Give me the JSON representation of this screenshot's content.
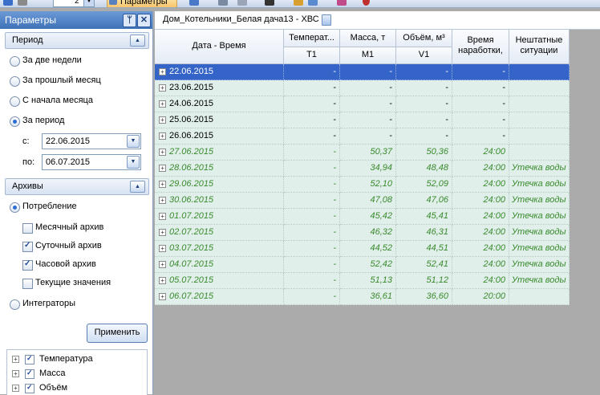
{
  "toolbar": {
    "spin_value": "2",
    "params_label": "Параметры"
  },
  "panel": {
    "title": "Параметры",
    "period": {
      "header": "Период",
      "options": [
        "За две недели",
        "За прошлый месяц",
        "С начала месяца",
        "За период"
      ],
      "selected": "За период",
      "from_label": "с:",
      "from_value": "22.06.2015",
      "to_label": "по:",
      "to_value": "06.07.2015"
    },
    "archives": {
      "header": "Архивы",
      "consumption_label": "Потребление",
      "checks": [
        {
          "label": "Месячный архив",
          "checked": false
        },
        {
          "label": "Суточный архив",
          "checked": true
        },
        {
          "label": "Часовой архив",
          "checked": true
        },
        {
          "label": "Текущие значения",
          "checked": false
        }
      ],
      "integrators_label": "Интеграторы"
    },
    "apply_label": "Применить",
    "tree": [
      {
        "label": "Температура",
        "checked": true
      },
      {
        "label": "Масса",
        "checked": true
      },
      {
        "label": "Объём",
        "checked": true
      }
    ]
  },
  "document": {
    "title": "Дом_Котельники_Белая дача13 - ХВС"
  },
  "grid": {
    "headers": {
      "date": "Дата - Время",
      "temp": "Температ...",
      "temp_sub": "T1",
      "mass": "Масса, т",
      "mass_sub": "M1",
      "vol": "Объём, м³",
      "vol_sub": "V1",
      "runtime1": "Время",
      "runtime2": "наработки,",
      "sit1": "Нештатные",
      "sit2": "ситуации"
    },
    "rows": [
      {
        "date": "22.06.2015",
        "temp": "-",
        "mass": "-",
        "vol": "-",
        "runtime": "-",
        "sit": "",
        "style": "sel"
      },
      {
        "date": "23.06.2015",
        "temp": "-",
        "mass": "-",
        "vol": "-",
        "runtime": "-",
        "sit": "",
        "style": "plain"
      },
      {
        "date": "24.06.2015",
        "temp": "-",
        "mass": "-",
        "vol": "-",
        "runtime": "-",
        "sit": "",
        "style": "plain"
      },
      {
        "date": "25.06.2015",
        "temp": "-",
        "mass": "-",
        "vol": "-",
        "runtime": "-",
        "sit": "",
        "style": "plain"
      },
      {
        "date": "26.06.2015",
        "temp": "-",
        "mass": "-",
        "vol": "-",
        "runtime": "-",
        "sit": "",
        "style": "plain"
      },
      {
        "date": "27.06.2015",
        "temp": "-",
        "mass": "50,37",
        "vol": "50,36",
        "runtime": "24:00",
        "sit": "",
        "style": "green"
      },
      {
        "date": "28.06.2015",
        "temp": "-",
        "mass": "34,94",
        "vol": "48,48",
        "runtime": "24:00",
        "sit": "Утечка воды",
        "style": "green"
      },
      {
        "date": "29.06.2015",
        "temp": "-",
        "mass": "52,10",
        "vol": "52,09",
        "runtime": "24:00",
        "sit": "Утечка воды",
        "style": "green"
      },
      {
        "date": "30.06.2015",
        "temp": "-",
        "mass": "47,08",
        "vol": "47,06",
        "runtime": "24:00",
        "sit": "Утечка воды",
        "style": "green"
      },
      {
        "date": "01.07.2015",
        "temp": "-",
        "mass": "45,42",
        "vol": "45,41",
        "runtime": "24:00",
        "sit": "Утечка воды",
        "style": "green"
      },
      {
        "date": "02.07.2015",
        "temp": "-",
        "mass": "46,32",
        "vol": "46,31",
        "runtime": "24:00",
        "sit": "Утечка воды",
        "style": "green"
      },
      {
        "date": "03.07.2015",
        "temp": "-",
        "mass": "44,52",
        "vol": "44,51",
        "runtime": "24:00",
        "sit": "Утечка воды",
        "style": "green"
      },
      {
        "date": "04.07.2015",
        "temp": "-",
        "mass": "52,42",
        "vol": "52,41",
        "runtime": "24:00",
        "sit": "Утечка воды",
        "style": "green"
      },
      {
        "date": "05.07.2015",
        "temp": "-",
        "mass": "51,13",
        "vol": "51,12",
        "runtime": "24:00",
        "sit": "Утечка воды",
        "style": "green"
      },
      {
        "date": "06.07.2015",
        "temp": "-",
        "mass": "36,61",
        "vol": "36,60",
        "runtime": "20:00",
        "sit": "",
        "style": "green"
      }
    ]
  }
}
